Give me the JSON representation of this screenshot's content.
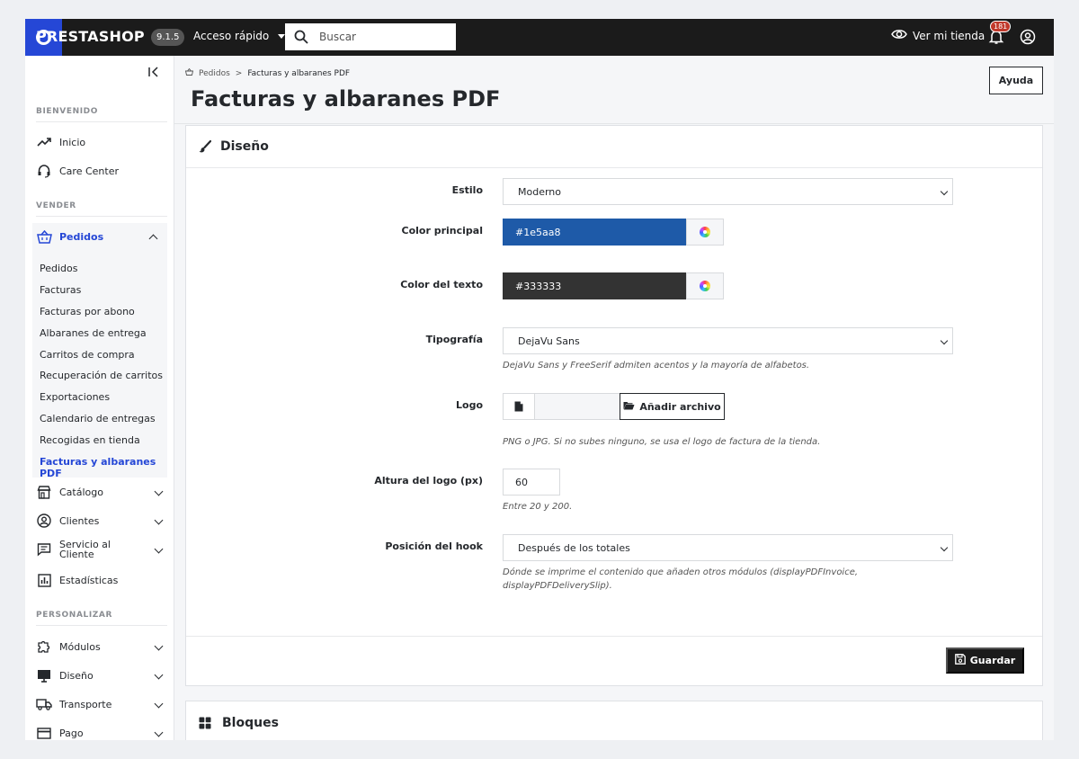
{
  "topbar": {
    "logo": "PRESTASHOP",
    "version": "9.1.5",
    "quick_access": "Acceso rápido",
    "search_placeholder": "Buscar",
    "view_store": "Ver mi tienda",
    "notifications_count": "181"
  },
  "sidebar": {
    "sections": [
      {
        "title": "BIENVENIDO"
      },
      {
        "title": "VENDER"
      },
      {
        "title": "PERSONALIZAR"
      }
    ],
    "welcome_items": [
      {
        "label": "Inicio",
        "icon": "trending-up-icon"
      },
      {
        "label": "Care Center",
        "icon": "headset-icon"
      }
    ],
    "orders": {
      "label": "Pedidos",
      "icon": "basket-icon",
      "children": [
        "Pedidos",
        "Facturas",
        "Facturas por abono",
        "Albaranes de entrega",
        "Carritos de compra",
        "Recuperación de carritos",
        "Exportaciones",
        "Calendario de entregas",
        "Recogidas en tienda",
        "Facturas y albaranes PDF"
      ],
      "active_child": "Facturas y albaranes PDF"
    },
    "sell_items": [
      {
        "label": "Catálogo",
        "icon": "store-icon"
      },
      {
        "label": "Clientes",
        "icon": "user-circle-icon"
      },
      {
        "label": "Servicio al Cliente",
        "icon": "chat-icon"
      },
      {
        "label": "Estadísticas",
        "icon": "chart-icon"
      }
    ],
    "custom_items": [
      {
        "label": "Módulos",
        "icon": "puzzle-icon"
      },
      {
        "label": "Diseño",
        "icon": "monitor-icon"
      },
      {
        "label": "Transporte",
        "icon": "truck-icon"
      },
      {
        "label": "Pago",
        "icon": "card-icon"
      }
    ]
  },
  "breadcrumb": {
    "parent": "Pedidos",
    "current": "Facturas y albaranes PDF"
  },
  "page": {
    "title": "Facturas y albaranes PDF",
    "help_button": "Ayuda"
  },
  "design_card": {
    "title": "Diseño",
    "style": {
      "label": "Estilo",
      "value": "Moderno"
    },
    "main_color": {
      "label": "Color principal",
      "value": "#1e5aa8",
      "color": "#1e5aa8"
    },
    "text_color": {
      "label": "Color del texto",
      "value": "#333333",
      "color": "#333333"
    },
    "typography": {
      "label": "Tipografía",
      "value": "DejaVu Sans",
      "help": "DejaVu Sans y FreeSerif admiten acentos y la mayoría de alfabetos."
    },
    "logo": {
      "label": "Logo",
      "button": "Añadir archivo",
      "help": "PNG o JPG. Si no subes ninguno, se usa el logo de factura de la tienda."
    },
    "logo_height": {
      "label": "Altura del logo (px)",
      "value": "60",
      "help": "Entre 20 y 200."
    },
    "hook_position": {
      "label": "Posición del hook",
      "value": "Después de los totales",
      "help": "Dónde se imprime el contenido que añaden otros módulos (displayPDFInvoice, displayPDFDeliverySlip)."
    },
    "save_button": "Guardar"
  },
  "blocks_card": {
    "title": "Bloques"
  }
}
